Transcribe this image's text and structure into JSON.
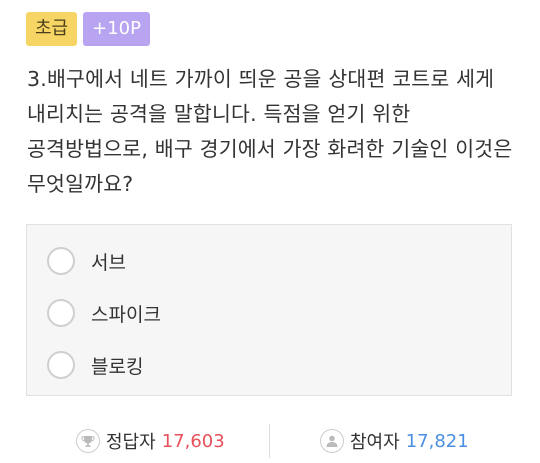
{
  "badges": {
    "level": "초급",
    "points": "+10P"
  },
  "question": {
    "text": "3.배구에서 네트 가까이 띄운 공을 상대편 코트로 세게 내리치는 공격을 말합니다. 득점을 얻기 위한 공격방법으로, 배구 경기에서 가장 화려한 기술인 이것은 무엇일까요?"
  },
  "options": [
    {
      "label": "서브",
      "selected": false
    },
    {
      "label": "스파이크",
      "selected": false
    },
    {
      "label": "블로킹",
      "selected": false
    }
  ],
  "stats": {
    "correct": {
      "icon": "trophy-icon",
      "label": "정답자",
      "value": "17,603",
      "color": "#e8505b"
    },
    "participants": {
      "icon": "user-icon",
      "label": "참여자",
      "value": "17,821",
      "color": "#4a8fe0"
    }
  }
}
